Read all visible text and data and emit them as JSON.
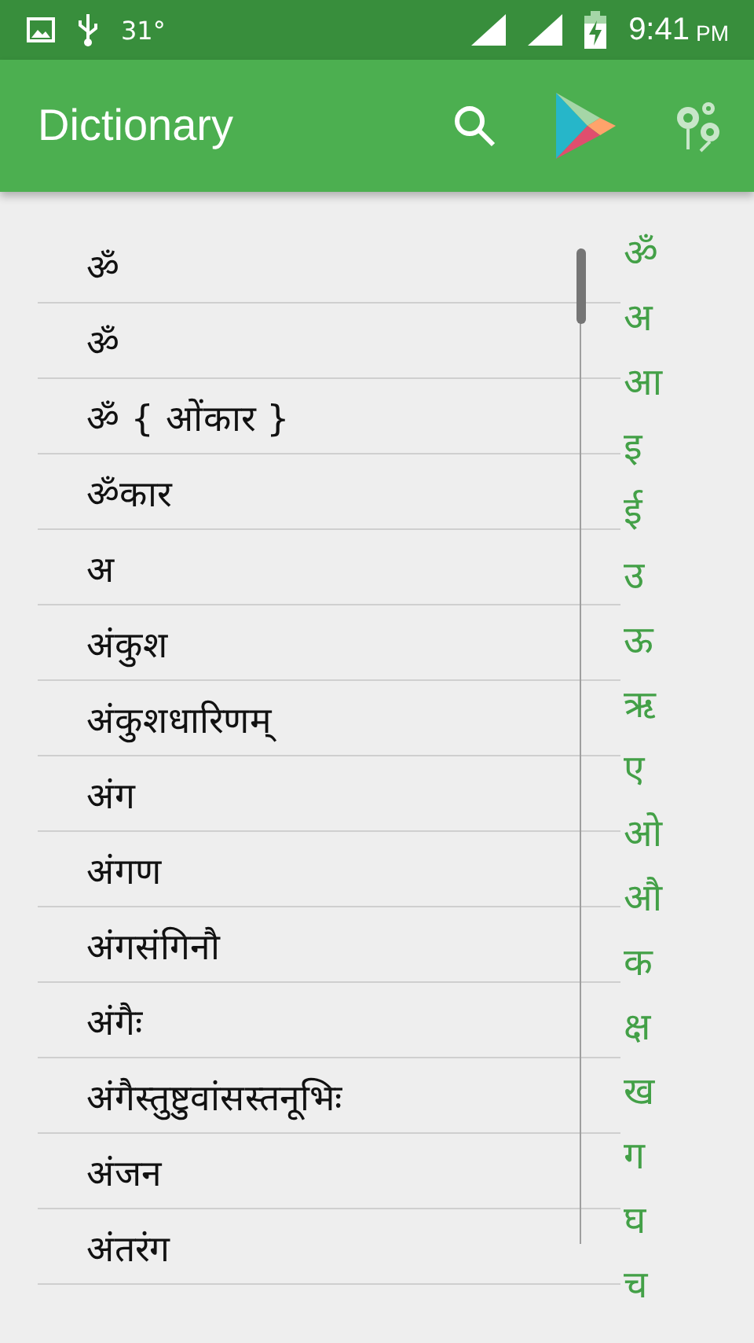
{
  "status_bar": {
    "temperature": "31°",
    "time": "9:41",
    "meridiem": "PM"
  },
  "app_bar": {
    "title": "Dictionary"
  },
  "words": [
    "ॐ",
    "ॐ",
    "ॐ { ओंकार }",
    "ॐकार",
    "अ",
    "अंकुश",
    "अंकुशधारिणम्",
    "अंग",
    "अंगण",
    "अंगसंगिनौ",
    "अंगैः",
    "अंगैस्तुष्टुवांसस्तनूभिः",
    "अंजन",
    "अंतरंग"
  ],
  "index": [
    {
      "label": "ॐ",
      "selected": false
    },
    {
      "label": "अ",
      "selected": false
    },
    {
      "label": "आ",
      "selected": false
    },
    {
      "label": "इ",
      "selected": false
    },
    {
      "label": "ई",
      "selected": false
    },
    {
      "label": "उ",
      "selected": false
    },
    {
      "label": "ऊ",
      "selected": false
    },
    {
      "label": "ऋ",
      "selected": false
    },
    {
      "label": "ए",
      "selected": false
    },
    {
      "label": "ओ",
      "selected": false
    },
    {
      "label": "औ",
      "selected": false
    },
    {
      "label": "क",
      "selected": false
    },
    {
      "label": "क्ष",
      "selected": false
    },
    {
      "label": "ख",
      "selected": false
    },
    {
      "label": "ग",
      "selected": false
    },
    {
      "label": "घ",
      "selected": false
    },
    {
      "label": "च",
      "selected": false
    }
  ]
}
